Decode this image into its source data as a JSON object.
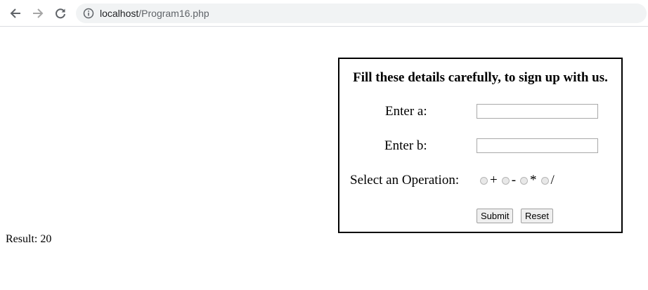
{
  "browser": {
    "url_host": "localhost",
    "url_path": "/Program16.php",
    "icons": {
      "back": "arrow-left-icon",
      "forward": "arrow-right-icon",
      "reload": "reload-icon",
      "site_info": "info-icon"
    }
  },
  "form": {
    "heading": "Fill these details carefully, to sign up with us.",
    "label_a": "Enter a:",
    "value_a": "",
    "label_b": "Enter b:",
    "value_b": "",
    "operation_label": "Select an Operation:",
    "operations": [
      "+",
      "-",
      "*",
      "/"
    ],
    "selected_operation": null,
    "submit_label": "Submit",
    "reset_label": "Reset"
  },
  "result": {
    "text": "Result: 20"
  }
}
